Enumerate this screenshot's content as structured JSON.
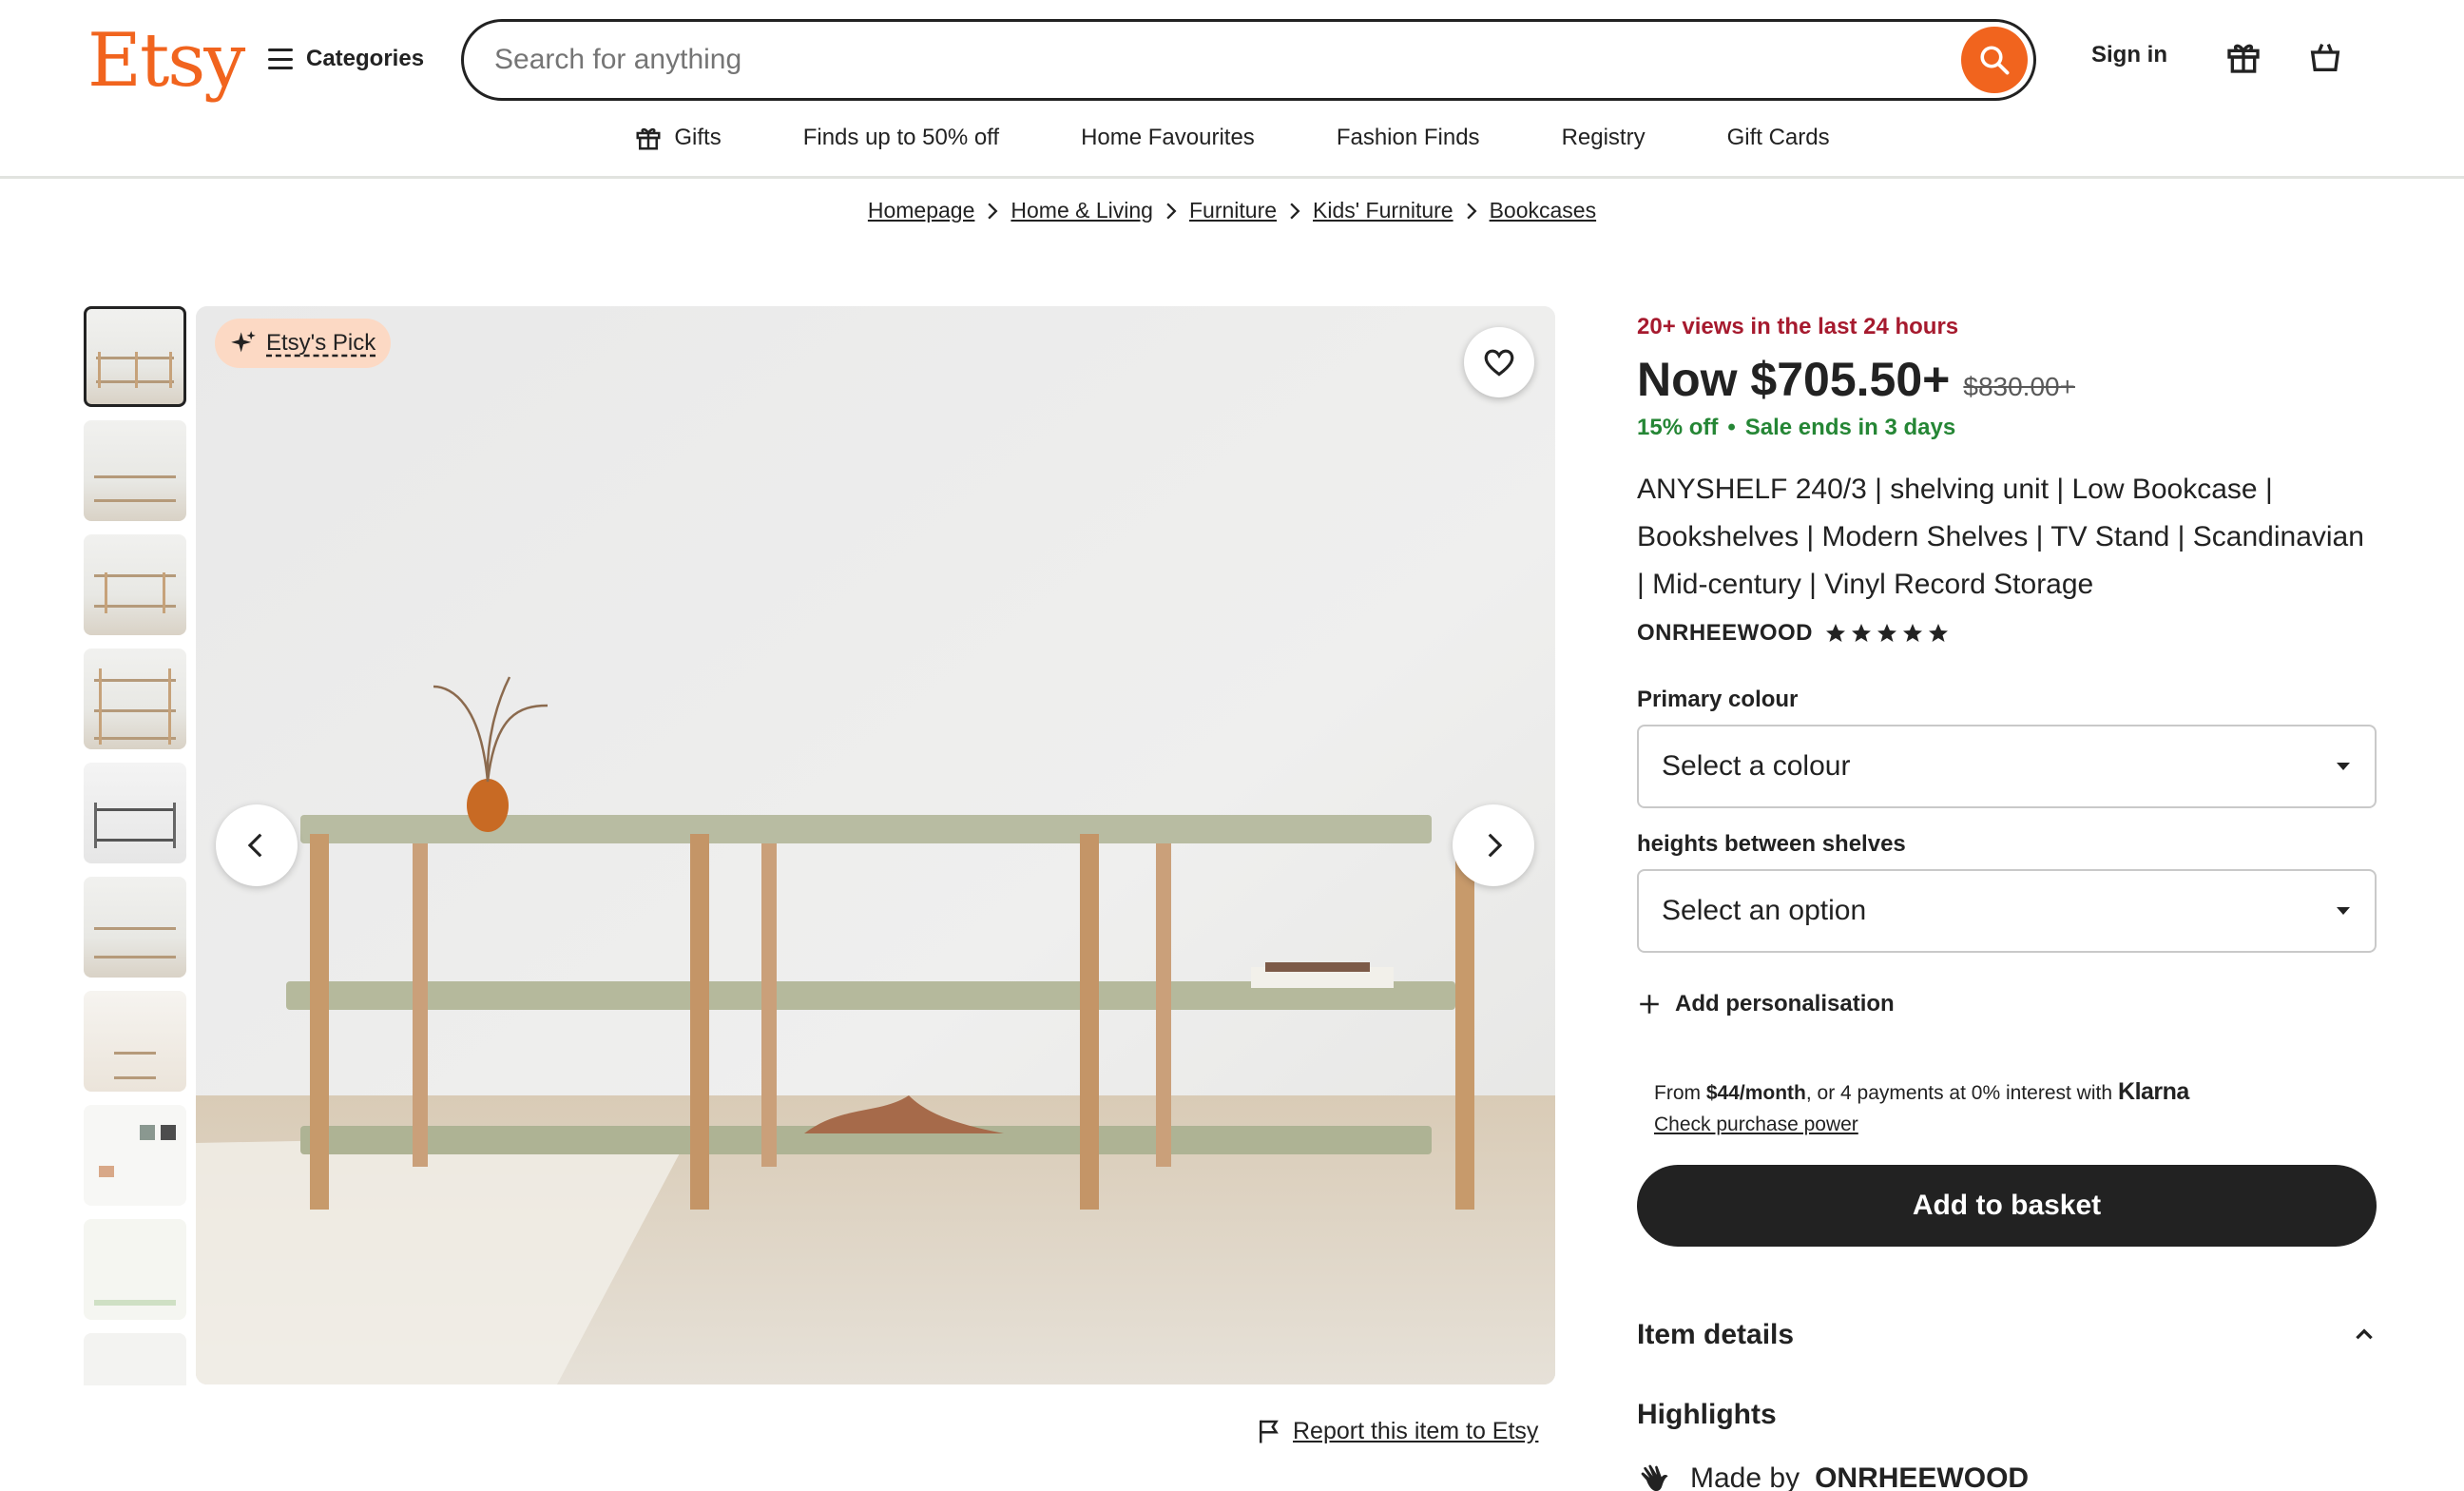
{
  "header": {
    "logo": "Etsy",
    "categories_label": "Categories",
    "search_placeholder": "Search for anything",
    "sign_in": "Sign in"
  },
  "subnav": {
    "items": [
      {
        "label": "Gifts",
        "icon": "gift-icon"
      },
      {
        "label": "Finds up to 50% off"
      },
      {
        "label": "Home Favourites"
      },
      {
        "label": "Fashion Finds"
      },
      {
        "label": "Registry"
      },
      {
        "label": "Gift Cards"
      }
    ]
  },
  "breadcrumb": [
    "Homepage",
    "Home & Living",
    "Furniture",
    "Kids' Furniture",
    "Bookcases"
  ],
  "gallery": {
    "badge": "Etsy's Pick",
    "report_label": "Report this item to Etsy"
  },
  "listing": {
    "views": "20+ views in the last 24 hours",
    "price": "Now $705.50+",
    "original_price": "$830.00+",
    "discount": "15% off",
    "sale_ends": "Sale ends in 3 days",
    "title": "ANYSHELF 240/3 | shelving unit | Low Bookcase | Bookshelves | Modern Shelves | TV Stand | Scandinavian | Mid-century | Vinyl Record Storage",
    "shop_name": "ONRHEEWOOD",
    "rating": 5,
    "option1_label": "Primary colour",
    "option1_value": "Select a colour",
    "option2_label": "heights between shelves",
    "option2_value": "Select an option",
    "add_personalisation": "Add personalisation",
    "klarna_from": "From ",
    "klarna_amount": "$44/month",
    "klarna_rest": ", or 4 payments at 0% interest with",
    "klarna_brand": "Klarna",
    "klarna_link": "Check purchase power",
    "add_to_basket": "Add to basket",
    "item_details": "Item details",
    "highlights": "Highlights",
    "made_by_prefix": "Made by",
    "made_by_shop": "ONRHEEWOOD"
  },
  "colors": {
    "brand": "#f1641e",
    "views_red": "#a61a2e",
    "sale_green": "#258635",
    "button_dark": "#222222",
    "badge_bg": "#fcd9c4"
  }
}
